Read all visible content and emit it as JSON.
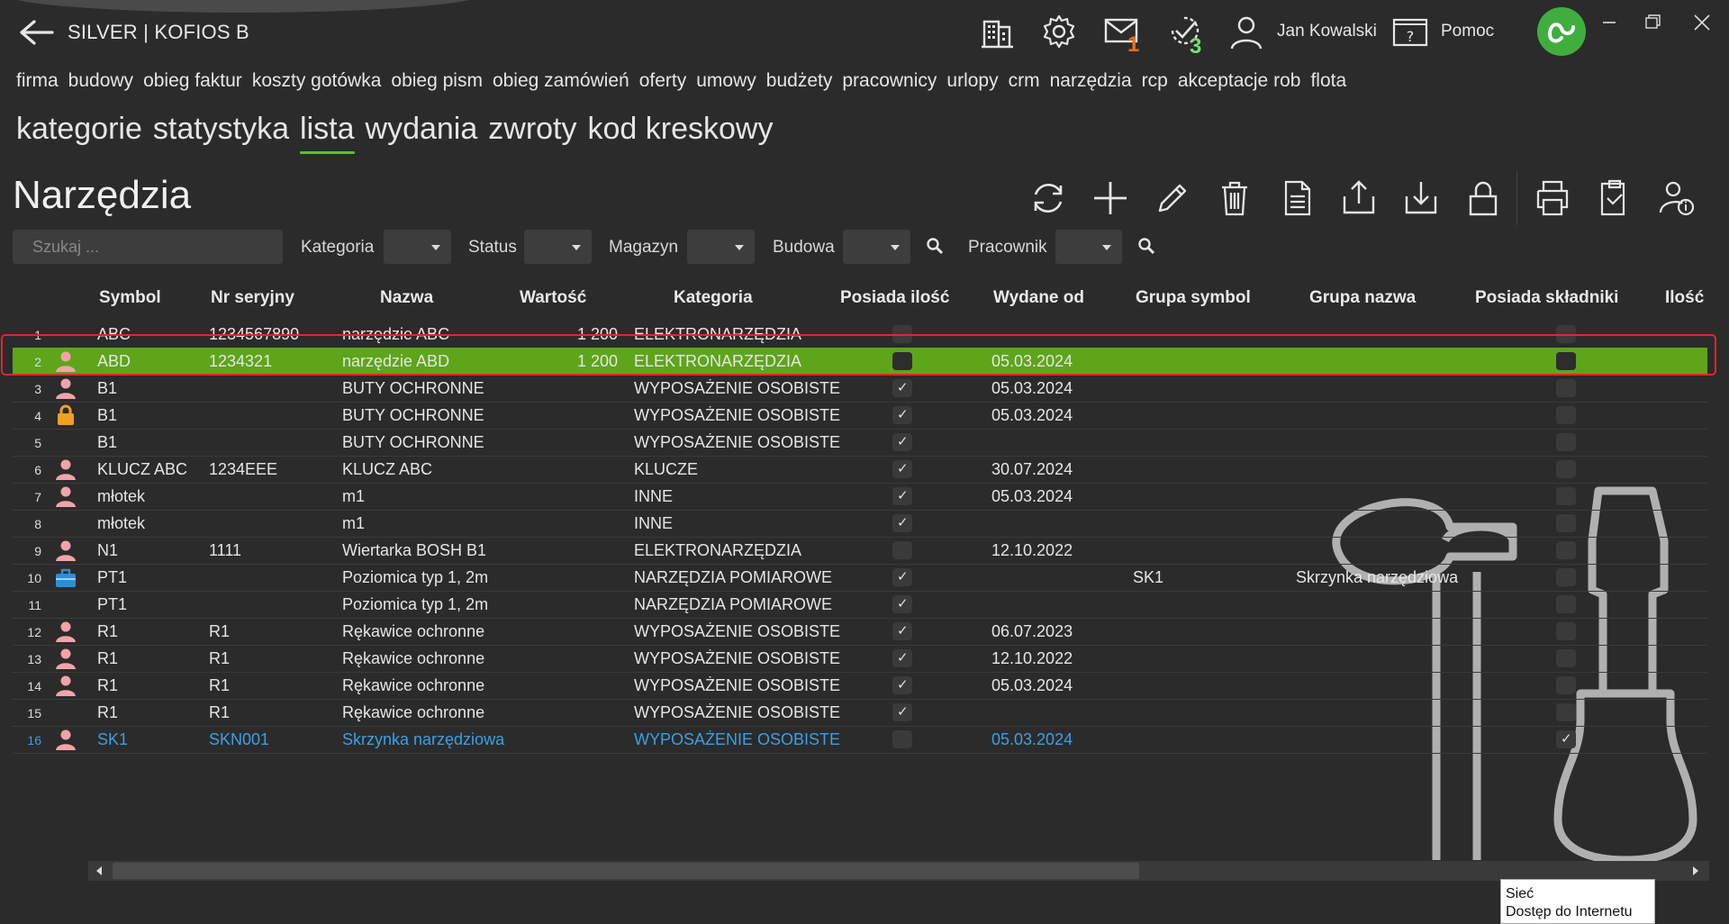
{
  "header": {
    "title": "SILVER | KOFIOS B",
    "mail_badge": "1",
    "tasks_badge": "3",
    "user_name": "Jan Kowalski",
    "help_label": "Pomoc",
    "icons": [
      "back-icon",
      "building-icon",
      "gear-icon",
      "mail-icon",
      "tasks-icon",
      "user-icon",
      "help-icon",
      "logo-icon"
    ]
  },
  "module_nav": [
    "firma",
    "budowy",
    "obieg faktur",
    "koszty gotówka",
    "obieg pism",
    "obieg zamówień",
    "oferty",
    "umowy",
    "budżety",
    "pracownicy",
    "urlopy",
    "crm",
    "narzędzia",
    "rcp",
    "akceptacje rob",
    "flota"
  ],
  "module_nav_active": "narzędzia",
  "sub_nav": [
    "kategorie",
    "statystyka",
    "lista",
    "wydania",
    "zwroty",
    "kod kreskowy"
  ],
  "sub_nav_active": "lista",
  "page_title": "Narzędzia",
  "filters": {
    "search_placeholder": "Szukaj ...",
    "kategoria": "Kategoria",
    "status": "Status",
    "magazyn": "Magazyn",
    "budowa": "Budowa",
    "pracownik": "Pracownik"
  },
  "columns": {
    "symbol": "Symbol",
    "serial": "Nr seryjny",
    "name": "Nazwa",
    "value": "Wartość",
    "category": "Kategoria",
    "has_qty": "Posiada ilość",
    "issued_from": "Wydane od",
    "group_symbol": "Grupa symbol",
    "group_name": "Grupa nazwa",
    "has_parts": "Posiada składniki",
    "qty": "Ilość"
  },
  "rows": [
    {
      "n": "1",
      "icon": "",
      "symbol": "ABC",
      "serial": "1234567890",
      "name": "narzędzie ABC",
      "value": "1 200",
      "category": "ELEKTRONARZĘDZIA",
      "has_qty": false,
      "issued": "",
      "gsym": "",
      "gname": "",
      "parts": false
    },
    {
      "n": "2",
      "icon": "person",
      "symbol": "ABD",
      "serial": "1234321",
      "name": "narzędzie ABD",
      "value": "1 200",
      "category": "ELEKTRONARZĘDZIA",
      "has_qty": false,
      "issued": "05.03.2024",
      "gsym": "",
      "gname": "",
      "parts": false
    },
    {
      "n": "3",
      "icon": "person",
      "symbol": "B1",
      "serial": "",
      "name": "BUTY OCHRONNE",
      "value": "",
      "category": "WYPOSAŻENIE OSOBISTE",
      "has_qty": true,
      "issued": "05.03.2024",
      "gsym": "",
      "gname": "",
      "parts": false
    },
    {
      "n": "4",
      "icon": "lock",
      "symbol": "B1",
      "serial": "",
      "name": "BUTY OCHRONNE",
      "value": "",
      "category": "WYPOSAŻENIE OSOBISTE",
      "has_qty": true,
      "issued": "05.03.2024",
      "gsym": "",
      "gname": "",
      "parts": false
    },
    {
      "n": "5",
      "icon": "",
      "symbol": "B1",
      "serial": "",
      "name": "BUTY OCHRONNE",
      "value": "",
      "category": "WYPOSAŻENIE OSOBISTE",
      "has_qty": true,
      "issued": "",
      "gsym": "",
      "gname": "",
      "parts": false
    },
    {
      "n": "6",
      "icon": "person",
      "symbol": "KLUCZ ABC",
      "serial": "1234EEE",
      "name": "KLUCZ ABC",
      "value": "",
      "category": "KLUCZE",
      "has_qty": true,
      "issued": "30.07.2024",
      "gsym": "",
      "gname": "",
      "parts": false
    },
    {
      "n": "7",
      "icon": "person",
      "symbol": "młotek",
      "serial": "",
      "name": "m1",
      "value": "",
      "category": "INNE",
      "has_qty": true,
      "issued": "05.03.2024",
      "gsym": "",
      "gname": "",
      "parts": false
    },
    {
      "n": "8",
      "icon": "",
      "symbol": "młotek",
      "serial": "",
      "name": "m1",
      "value": "",
      "category": "INNE",
      "has_qty": true,
      "issued": "",
      "gsym": "",
      "gname": "",
      "parts": false
    },
    {
      "n": "9",
      "icon": "person",
      "symbol": "N1",
      "serial": "1111",
      "name": "Wiertarka BOSH B1",
      "value": "",
      "category": "ELEKTRONARZĘDZIA",
      "has_qty": false,
      "issued": "12.10.2022",
      "gsym": "",
      "gname": "",
      "parts": false
    },
    {
      "n": "10",
      "icon": "toolbox",
      "symbol": "PT1",
      "serial": "",
      "name": "Poziomica typ 1, 2m",
      "value": "",
      "category": "NARZĘDZIA POMIAROWE",
      "has_qty": true,
      "issued": "",
      "gsym": "SK1",
      "gname": "Skrzynka narzędziowa",
      "parts": false
    },
    {
      "n": "11",
      "icon": "",
      "symbol": "PT1",
      "serial": "",
      "name": "Poziomica typ 1, 2m",
      "value": "",
      "category": "NARZĘDZIA POMIAROWE",
      "has_qty": true,
      "issued": "",
      "gsym": "",
      "gname": "",
      "parts": false
    },
    {
      "n": "12",
      "icon": "person",
      "symbol": "R1",
      "serial": "R1",
      "name": "Rękawice ochronne",
      "value": "",
      "category": "WYPOSAŻENIE OSOBISTE",
      "has_qty": true,
      "issued": "06.07.2023",
      "gsym": "",
      "gname": "",
      "parts": false
    },
    {
      "n": "13",
      "icon": "person",
      "symbol": "R1",
      "serial": "R1",
      "name": "Rękawice ochronne",
      "value": "",
      "category": "WYPOSAŻENIE OSOBISTE",
      "has_qty": true,
      "issued": "12.10.2022",
      "gsym": "",
      "gname": "",
      "parts": false
    },
    {
      "n": "14",
      "icon": "person",
      "symbol": "R1",
      "serial": "R1",
      "name": "Rękawice ochronne",
      "value": "",
      "category": "WYPOSAŻENIE OSOBISTE",
      "has_qty": true,
      "issued": "05.03.2024",
      "gsym": "",
      "gname": "",
      "parts": false
    },
    {
      "n": "15",
      "icon": "",
      "symbol": "R1",
      "serial": "R1",
      "name": "Rękawice ochronne",
      "value": "",
      "category": "WYPOSAŻENIE OSOBISTE",
      "has_qty": true,
      "issued": "",
      "gsym": "",
      "gname": "",
      "parts": false
    },
    {
      "n": "16",
      "icon": "person",
      "symbol": "SK1",
      "serial": "SKN001",
      "name": "Skrzynka narzędziowa",
      "value": "",
      "category": "WYPOSAŻENIE OSOBISTE",
      "has_qty": false,
      "issued": "05.03.2024",
      "gsym": "",
      "gname": "",
      "parts": true
    }
  ],
  "selected_row": "2",
  "link_row": "16",
  "tooltip": {
    "line1": "Sieć",
    "line2": "Dostęp do Internetu"
  },
  "colors": {
    "selected": "#5ea51a",
    "link": "#3aa0e6",
    "accent": "#5fbf2f",
    "highlight": "#e02828"
  }
}
